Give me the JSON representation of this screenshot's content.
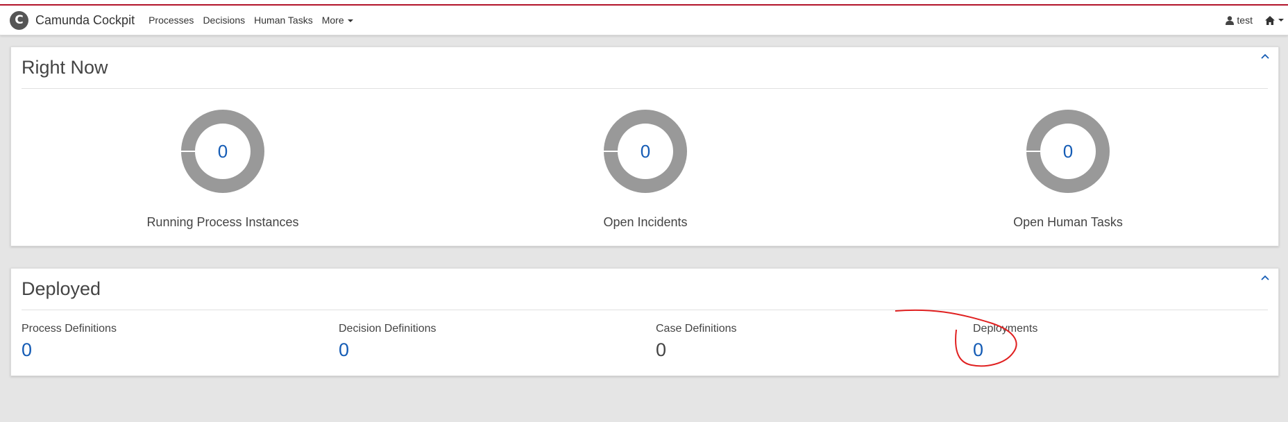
{
  "app": {
    "name": "Camunda Cockpit",
    "logo_letter": "C"
  },
  "nav": {
    "items": [
      "Processes",
      "Decisions",
      "Human Tasks",
      "More"
    ]
  },
  "user": {
    "name": "test"
  },
  "colors": {
    "accent_line": "#b5152b",
    "link_blue": "#155cb5",
    "donut_gray": "#999999"
  },
  "right_now": {
    "title": "Right Now",
    "stats": [
      {
        "label": "Running Process Instances",
        "value": "0"
      },
      {
        "label": "Open Incidents",
        "value": "0"
      },
      {
        "label": "Open Human Tasks",
        "value": "0"
      }
    ]
  },
  "deployed": {
    "title": "Deployed",
    "items": [
      {
        "label": "Process Definitions",
        "value": "0"
      },
      {
        "label": "Decision Definitions",
        "value": "0"
      },
      {
        "label": "Case Definitions",
        "value": "0"
      },
      {
        "label": "Deployments",
        "value": "0"
      }
    ]
  }
}
